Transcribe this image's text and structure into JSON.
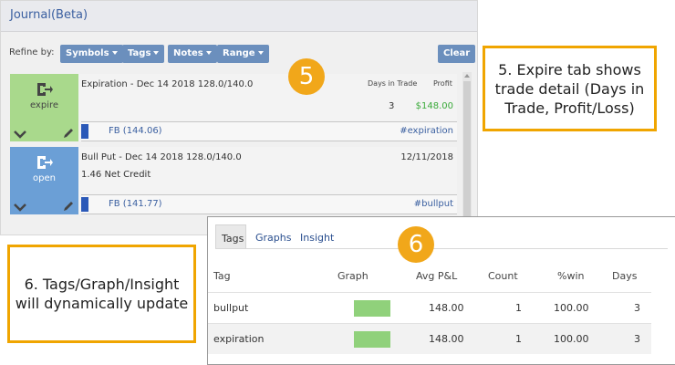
{
  "journal": {
    "title": "Journal(Beta)",
    "refine_label": "Refine by:",
    "filters": [
      "Symbols",
      "Tags",
      "Notes",
      "Range"
    ],
    "clear_label": "Clear",
    "trades": [
      {
        "status": "expire",
        "status_color": "#a9d98c",
        "title": "Expiration - Dec 14 2018 128.0/140.0",
        "days_header": "Days in Trade",
        "profit_header": "Profit",
        "days": "3",
        "profit": "$148.00",
        "symbol": "FB (144.06)",
        "tag": "#expiration"
      },
      {
        "status": "open",
        "status_color": "#6b9fd6",
        "title": "Bull Put - Dec 14 2018 128.0/140.0",
        "subtitle": "1.46 Net Credit",
        "date": "12/11/2018",
        "symbol": "FB (141.77)",
        "tag": "#bullput"
      }
    ]
  },
  "markers": {
    "five": "5",
    "six": "6"
  },
  "callouts": {
    "five": "5. Expire tab shows trade detail (Days in Trade, Profit/Loss)",
    "six": "6. Tags/Graph/Insight will dynamically update"
  },
  "insight": {
    "tabs": [
      "Tags",
      "Graphs",
      "Insight"
    ],
    "active_tab": "Tags",
    "columns": [
      "Tag",
      "Graph",
      "Avg P&L",
      "Count",
      "%win",
      "Days"
    ],
    "rows": [
      {
        "tag": "bullput",
        "graph_fill": 1.0,
        "avg_pl": "148.00",
        "count": "1",
        "win": "100.00",
        "days": "3"
      },
      {
        "tag": "expiration",
        "graph_fill": 1.0,
        "avg_pl": "148.00",
        "count": "1",
        "win": "100.00",
        "days": "3"
      }
    ]
  },
  "colors": {
    "accent_orange": "#f1a71a",
    "filter_button": "#6b8fbd",
    "profit_green": "#3aaa3a",
    "graph_bar": "#90d17b"
  }
}
